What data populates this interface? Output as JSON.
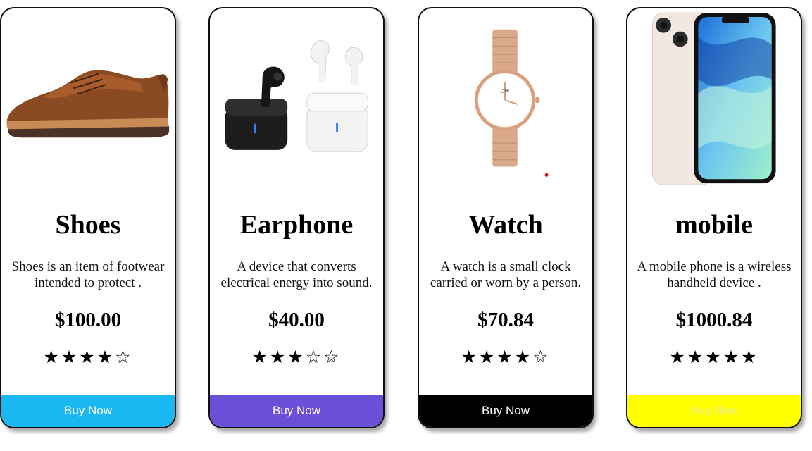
{
  "cards": [
    {
      "title": "Shoes",
      "description_line1": "Shoes is an item of footwear",
      "description_line2": "intended to protect .",
      "price": "$100.00",
      "stars": "★★★★☆",
      "rating": "4 of 5",
      "button_label": "Buy Now",
      "button_color": "#1bb7f0",
      "button_text_color": "#ffffff"
    },
    {
      "title": "Earphone",
      "description_line1": "A device that converts",
      "description_line2": "electrical energy into sound.",
      "price": "$40.00",
      "stars": "★★★☆☆",
      "rating": "3 of 5",
      "button_label": "Buy Now",
      "button_color": "#6a4fd9",
      "button_text_color": "#ffffff"
    },
    {
      "title": "Watch",
      "description_line1": "A watch is a small clock",
      "description_line2": "carried or worn by a person.",
      "price": "$70.84",
      "stars": "★★★★☆",
      "rating": "4 of 5",
      "button_label": "Buy Now",
      "button_color": "#000000",
      "button_text_color": "#ffffff"
    },
    {
      "title": "mobile",
      "description_line1": "A mobile phone is a wireless",
      "description_line2": "handheld device .",
      "price": "$1000.84",
      "stars": "★★★★★",
      "rating": "5 of 5",
      "button_label": "Buy Now",
      "button_color": "#ffff00",
      "button_text_color": "#e9e9a0"
    }
  ],
  "images": {
    "watch_brand": "DW"
  }
}
